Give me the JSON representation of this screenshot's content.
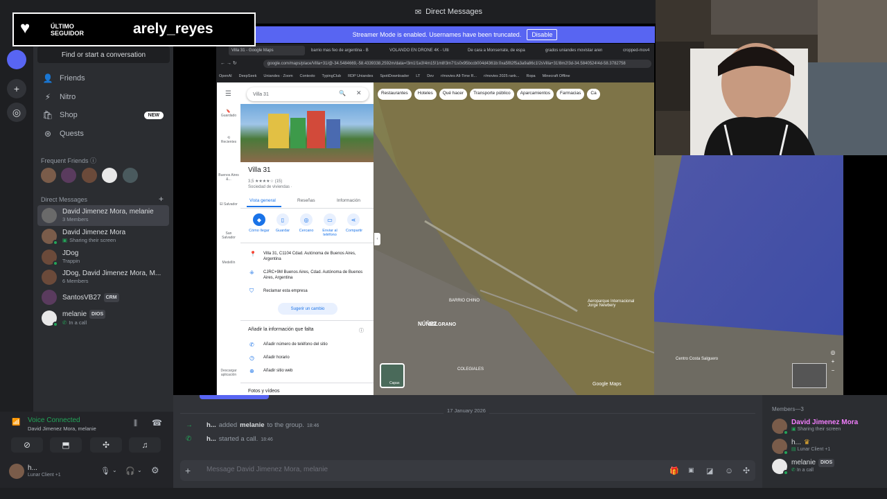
{
  "window": {
    "title": "Direct Messages"
  },
  "overlay": {
    "label_top": "ÚLTIMO",
    "label_bottom": "SEGUIDOR",
    "follower_name": "arely_reyes"
  },
  "sidebar": {
    "search_placeholder": "Find or start a conversation",
    "nav": [
      {
        "label": "Friends",
        "icon": "friends-icon"
      },
      {
        "label": "Nitro",
        "icon": "nitro-icon"
      },
      {
        "label": "Shop",
        "icon": "shop-icon",
        "badge": "NEW"
      },
      {
        "label": "Quests",
        "icon": "quests-icon"
      }
    ],
    "frequent_friends": "Frequent Friends",
    "direct_messages": "Direct Messages",
    "dms": [
      {
        "name": "David Jimenez Mora, melanie",
        "sub": "3 Members",
        "selected": true
      },
      {
        "name": "David Jimenez Mora",
        "sub": "Sharing their screen"
      },
      {
        "name": "JDog",
        "sub": "Trappin"
      },
      {
        "name": "JDog, David Jimenez Mora, M...",
        "sub": "6 Members"
      },
      {
        "name": "SantosVB27",
        "sub": "",
        "tag": "CRM"
      },
      {
        "name": "melanie",
        "sub": "In a call",
        "tag": "DIOS"
      }
    ]
  },
  "voice": {
    "status": "Voice Connected",
    "channel": "David Jimenez Mora, melanie"
  },
  "user": {
    "name": "h...",
    "status": "Lunar Client +1"
  },
  "stream": {
    "banner_text": "Streamer Mode is enabled. Usernames have been truncated.",
    "banner_button": "Disable",
    "tabs": [
      "Villa 31 - Google Maps",
      "barrio mas feo de argentina - B",
      "VOLANDO EN DRONE 4K - Ulti",
      "De cara a Monserrate, de espa",
      "grados uniandes movistar aren",
      "cropped-mov4"
    ],
    "url": "google.com/maps/place/Villa+31/@-34.5484669,-58.4339338,2592m/data=!3m1!1e3!4m15!1m8!3m7!1s0x95bccb004d4361b:0xa5f82f5a3a9a86c1!2sVilla+31!8m2!3d-34.5840524!4d-58.3782758",
    "bookmarks": [
      "OpenAI",
      "DeepSeek",
      "Uniandes · Zoom",
      "Contexto",
      "TypingClub",
      "RDP Uniandes",
      "SpotiDownloader",
      "LT",
      "Dev",
      "r/movies All-Time R...",
      "r/movies 2025 rank...",
      "Ropa",
      "Minecraft Offline"
    ],
    "map_search": "Villa 31",
    "place_name": "Villa 31",
    "rating": "3,5 ★★★★☆ (15)",
    "category": "Sociedad de viviendas ·",
    "place_tabs": [
      "Vista general",
      "Reseñas",
      "Información"
    ],
    "actions": [
      "Cómo llegar",
      "Guardar",
      "Cercano",
      "Enviar al teléfono",
      "Compartir"
    ],
    "address": "Villa 31, C1104 Cdad. Autónoma de Buenos Aires, Argentina",
    "plus_code": "CJRC+9M Buenos Aires, Cdad. Autónoma de Buenos Aires, Argentina",
    "claim": "Reclamar esta empresa",
    "suggest": "Sugerir un cambio",
    "missing_info": "Añadir la información que falta",
    "add_items": [
      "Añadir número de teléfono del sitio",
      "Añadir horario",
      "Añadir sitio web"
    ],
    "photos": "Fotos y vídeos",
    "chips": [
      "Restaurantes",
      "Hoteles",
      "Qué hacer",
      "Transporte público",
      "Aparcamientos",
      "Farmacias",
      "Ca"
    ],
    "left_nav": [
      "Menú",
      "Guardado",
      "Recientes",
      "Buenos Aires &...",
      "El Salvador",
      "San Salvador",
      "Medellín",
      "Descargar aplicación"
    ],
    "map_labels": [
      "NÚÑEZ",
      "BARRIO CHINO",
      "BELGRANO",
      "COLEGIALES",
      "BELGRANO",
      "Aeroparque Internacional Jorge Newbery",
      "Centro Costa Salguero",
      "Google Maps",
      "Capas"
    ]
  },
  "chat": {
    "date": "17 January 2026",
    "messages": [
      {
        "user": "h...",
        "action": "added",
        "target": "melanie",
        "tail": "to the group.",
        "time": "18:46"
      },
      {
        "user": "h...",
        "action": "started a call.",
        "target": "",
        "tail": "",
        "time": "18:46"
      }
    ],
    "input_placeholder": "Message David Jimenez Mora, melanie"
  },
  "members": {
    "header": "Members—3",
    "list": [
      {
        "name": "David Jimenez Mora",
        "sub": "Sharing their screen",
        "color": "#f47fff"
      },
      {
        "name": "h...",
        "sub": "Lunar Client +1",
        "color": "#dbdee1"
      },
      {
        "name": "melanie",
        "sub": "In a call",
        "color": "#dbdee1",
        "tag": "DIOS"
      }
    ]
  }
}
